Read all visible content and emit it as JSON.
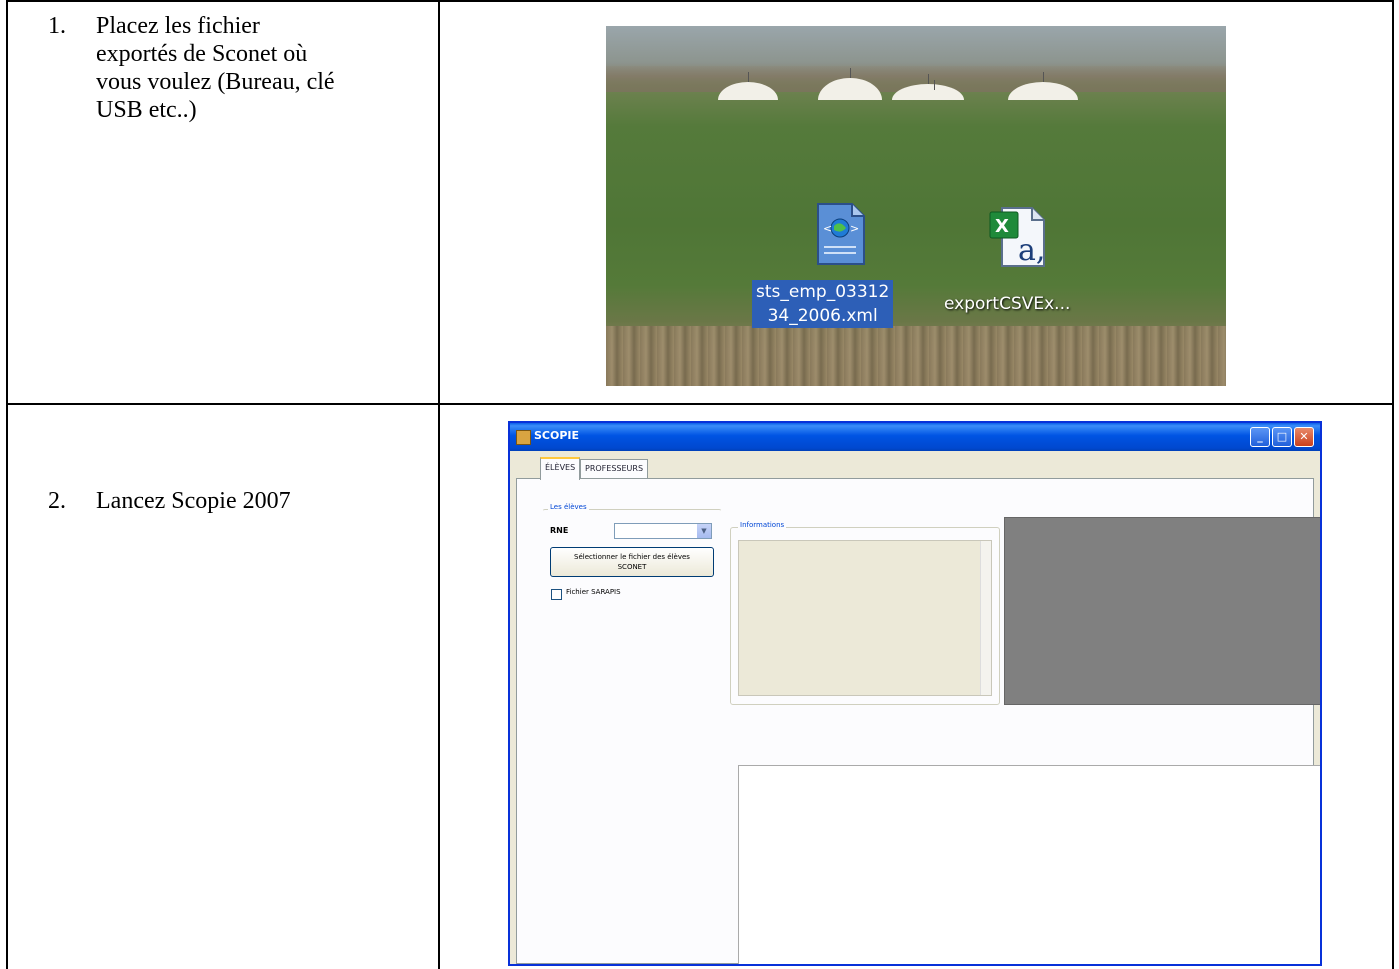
{
  "steps": [
    {
      "number": "1.",
      "lines": [
        "Placez les fichier",
        "exportés de Sconet où",
        "vous voulez (Bureau, clé",
        "USB etc..)"
      ]
    },
    {
      "number": "2.",
      "lines": [
        "Lancez Scopie 2007"
      ]
    }
  ],
  "desktop": {
    "icons": [
      {
        "name": "xml-file-icon",
        "label_lines": [
          "sts_emp_03312",
          "34_2006.xml"
        ],
        "selected": true
      },
      {
        "name": "csv-excel-file-icon",
        "label_lines": [
          "exportCSVEx..."
        ],
        "selected": false
      }
    ]
  },
  "scopie_window": {
    "title": "SCOPIE",
    "window_buttons": {
      "minimize": "_",
      "maximize": "□",
      "close": "✕"
    },
    "tabs": [
      {
        "label": "ÉLÈVES",
        "active": true
      },
      {
        "label": "PROFESSEURS",
        "active": false
      }
    ],
    "eleves_group_label": "Les élèves",
    "rne_label": "RNE",
    "rne_value": "",
    "select_button_lines": [
      "Sélectionner le fichier des élèves",
      "SCONET"
    ],
    "sarapis_checkbox": {
      "label": "Fichier SARAPIS",
      "checked": false
    },
    "informations_label": "Informations"
  },
  "colors": {
    "selection_blue": "#2d5fb7",
    "xp_title_blue": "#0054e3",
    "dark_panel": "#808080"
  }
}
